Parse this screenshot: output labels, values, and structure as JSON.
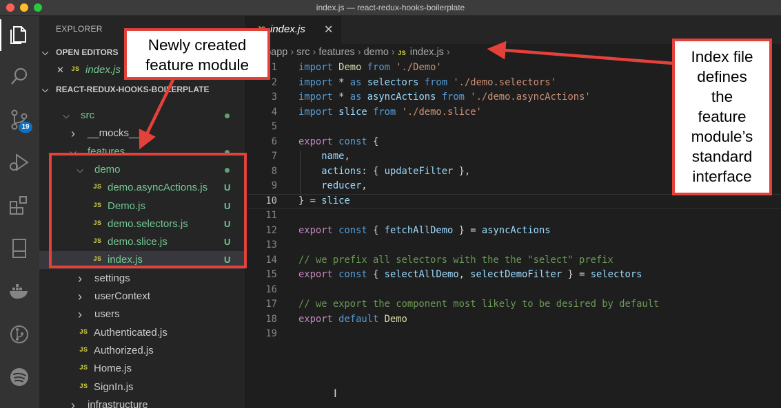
{
  "window": {
    "title": "index.js — react-redux-hooks-boilerplate"
  },
  "activity_bar": {
    "scm_badge": "19",
    "icons": [
      "files-icon",
      "search-icon",
      "source-control-icon",
      "debug-icon",
      "extensions-icon",
      "remote-explorer-icon",
      "docker-icon",
      "gitlens-icon",
      "spotify-icon"
    ]
  },
  "sidebar": {
    "title": "EXPLORER",
    "open_editors": {
      "header": "OPEN EDITORS",
      "items": [
        {
          "close": "✕",
          "badge": "JS",
          "label": "index.js"
        }
      ]
    },
    "project": {
      "header": "REACT-REDUX-HOOKS-BOILERPLATE",
      "tree": [
        {
          "type": "folder",
          "open": true,
          "label": "src",
          "status": "dot"
        },
        {
          "type": "folder",
          "open": false,
          "label": "__mocks__"
        },
        {
          "type": "folder",
          "open": true,
          "label": "features",
          "status": "dot"
        },
        {
          "type": "folder",
          "open": true,
          "label": "demo",
          "status": "dot"
        },
        {
          "type": "file",
          "badge": "JS",
          "label": "demo.asyncActions.js",
          "status": "U"
        },
        {
          "type": "file",
          "badge": "JS",
          "label": "Demo.js",
          "status": "U"
        },
        {
          "type": "file",
          "badge": "JS",
          "label": "demo.selectors.js",
          "status": "U"
        },
        {
          "type": "file",
          "badge": "JS",
          "label": "demo.slice.js",
          "status": "U"
        },
        {
          "type": "file",
          "badge": "JS",
          "label": "index.js",
          "status": "U",
          "selected": true
        },
        {
          "type": "folder",
          "open": false,
          "label": "settings"
        },
        {
          "type": "folder",
          "open": false,
          "label": "userContext"
        },
        {
          "type": "folder",
          "open": false,
          "label": "users"
        },
        {
          "type": "file",
          "badge": "JS",
          "label": "Authenticated.js"
        },
        {
          "type": "file",
          "badge": "JS",
          "label": "Authorized.js"
        },
        {
          "type": "file",
          "badge": "JS",
          "label": "Home.js"
        },
        {
          "type": "file",
          "badge": "JS",
          "label": "SignIn.js"
        },
        {
          "type": "folder",
          "open": false,
          "label": "infrastructure"
        }
      ]
    }
  },
  "editor": {
    "tab": {
      "badge": "JS",
      "label": "index.js",
      "close": "✕"
    },
    "breadcrumb": [
      "ebapp",
      "src",
      "features",
      "demo",
      "index.js"
    ],
    "breadcrumb_badge": "JS",
    "lines": [
      "import Demo from './Demo'",
      "import * as selectors from './demo.selectors'",
      "import * as asyncActions from './demo.asyncActions'",
      "import slice from './demo.slice'",
      "",
      "export const {",
      "    name,",
      "    actions: { updateFilter },",
      "    reducer,",
      "} = slice",
      "",
      "export const { fetchAllDemo } = asyncActions",
      "",
      "// we prefix all selectors with the the \"select\" prefix",
      "export const { selectAllDemo, selectDemoFilter } = selectors",
      "",
      "// we export the component most likely to be desired by default",
      "export default Demo",
      ""
    ],
    "current_line": 10
  },
  "annotations": {
    "left": {
      "lines": [
        "Newly created",
        "feature module"
      ]
    },
    "right": {
      "lines": [
        "Index file",
        "defines",
        "the",
        "feature",
        "module’s",
        "standard",
        "interface"
      ]
    }
  },
  "colors": {
    "annotation_red": "#e4413b",
    "untracked_green": "#73c991",
    "js_yellow": "#cbcb41"
  }
}
